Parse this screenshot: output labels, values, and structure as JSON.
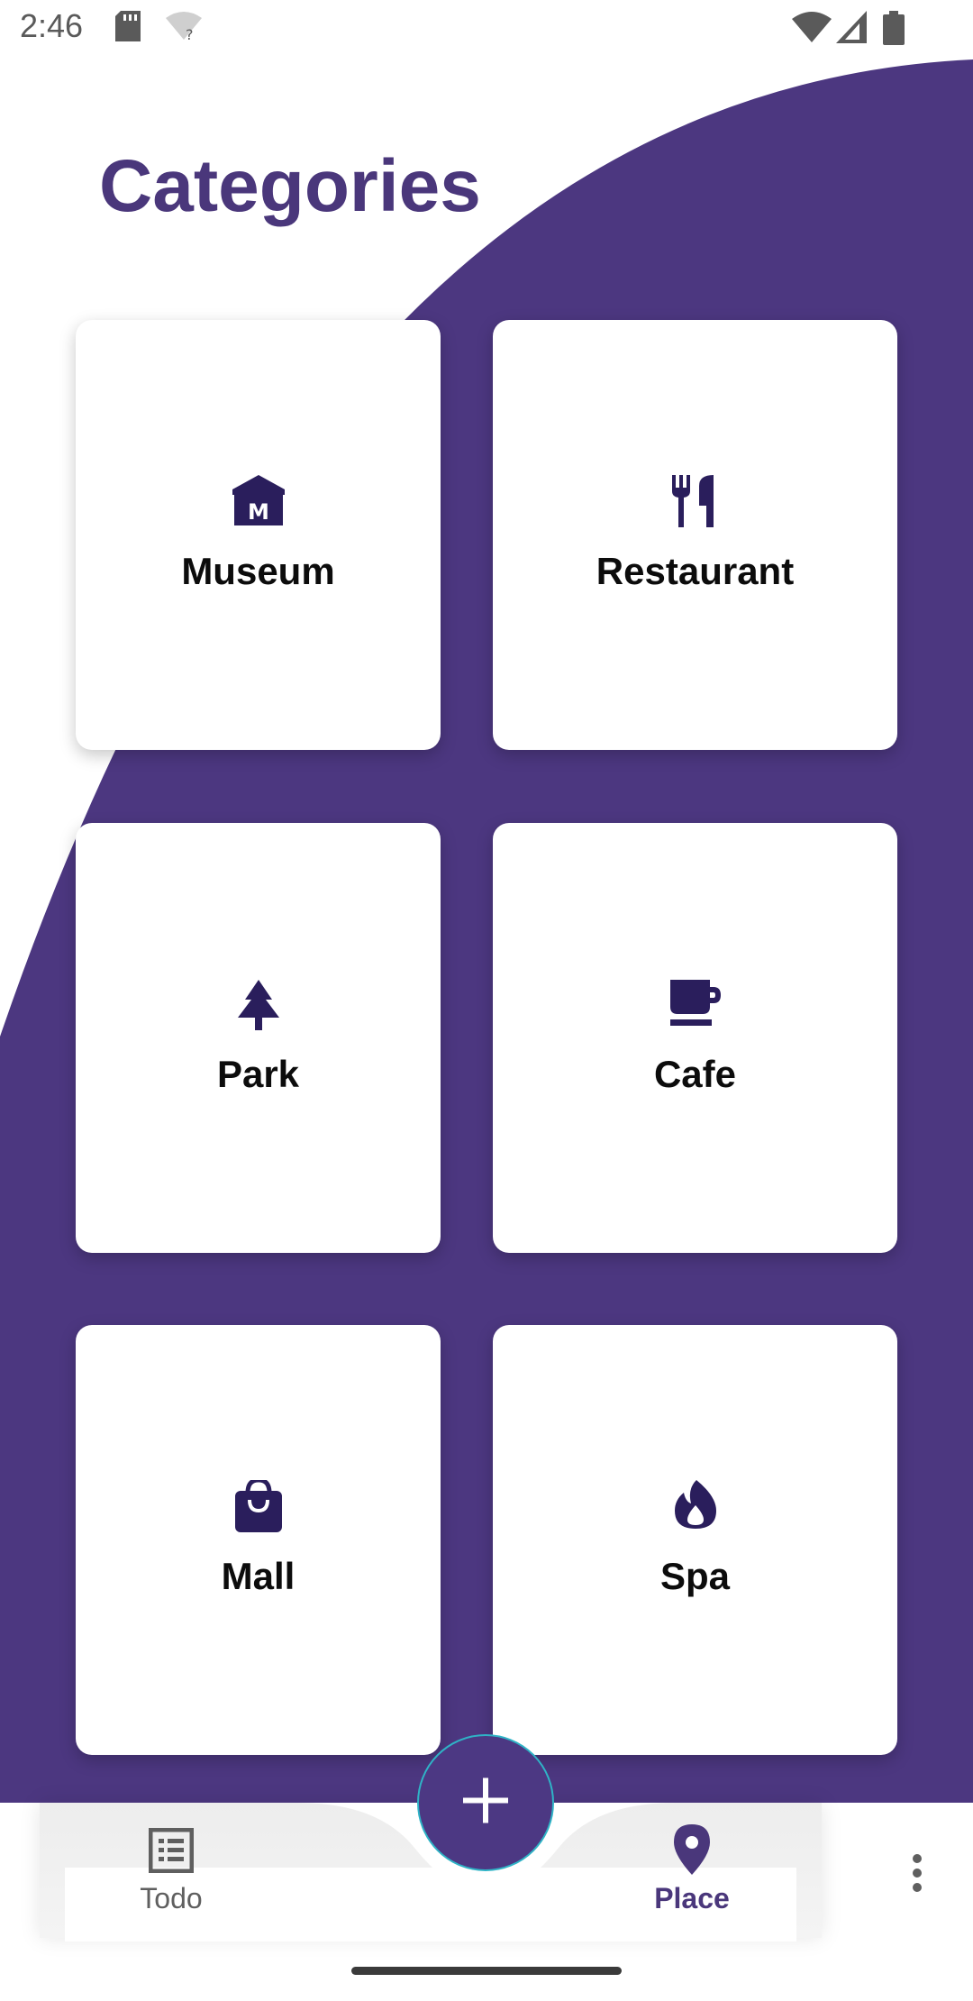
{
  "status_bar": {
    "time": "2:46",
    "icons": [
      "sd-card-icon",
      "wifi-question-icon",
      "wifi-icon",
      "signal-icon",
      "battery-icon"
    ]
  },
  "header": {
    "title": "Categories"
  },
  "categories": [
    {
      "label": "Museum",
      "icon": "museum-icon"
    },
    {
      "label": "Restaurant",
      "icon": "restaurant-icon"
    },
    {
      "label": "Park",
      "icon": "park-icon"
    },
    {
      "label": "Cafe",
      "icon": "cafe-icon"
    },
    {
      "label": "Mall",
      "icon": "mall-icon"
    },
    {
      "label": "Spa",
      "icon": "spa-icon"
    }
  ],
  "bottom_nav": {
    "items": [
      {
        "label": "Todo",
        "icon": "todo-list-icon",
        "active": false
      },
      {
        "label": "Place",
        "icon": "place-pin-icon",
        "active": true
      }
    ],
    "fab_icon": "add-icon",
    "more_icon": "more-vert-icon"
  },
  "colors": {
    "accent": "#4a377b",
    "icon": "#2a1e5c",
    "card": "#ffffff",
    "inactive_nav": "#5f5f5f",
    "fab_border": "#2fb3c6"
  }
}
